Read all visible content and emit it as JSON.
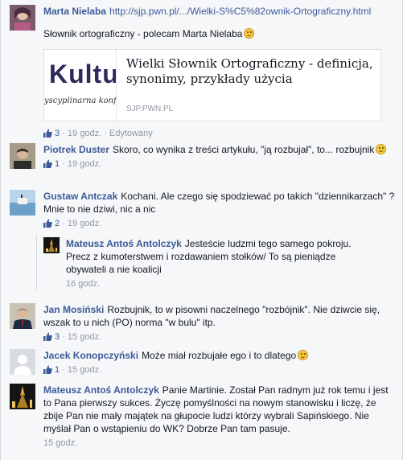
{
  "post": {
    "author": "Marta Nielaba",
    "url": "http://sjp.pwn.pl/.../Wielki-S%C5%82ownik-Ortograficzny.html",
    "text": "Słownik ortograficzny - polecam Marta Nielaba",
    "preview": {
      "logo_text": "Kultu",
      "logo_subtext": "yscyplinarna konf",
      "title": "Wielki Słownik Ortograficzny - definicja, synonimy, przykłady użycia",
      "source": "SJP.PWN.PL"
    },
    "likes": "3",
    "time": "19 godz.",
    "edited": "Edytowany"
  },
  "comments": [
    {
      "author": "Piotrek Duster",
      "text": "Skoro, co wynika z treści artykułu, \"ją rozbujał\", to... rozbujnik",
      "likes": "1",
      "time": "19 godz."
    },
    {
      "author": "Gustaw Antczak",
      "text": "Kochani. Ale czego się spodziewać po takich \"dziennikarzach\" ? Mnie to nie dziwi, nic a nic",
      "likes": "2",
      "time": "19 godz."
    },
    {
      "author": "Mateusz Antoś Antolczyk",
      "text": "Jesteście ludzmi tego samego pokroju. Precz z kumoterstwem i rozdawaniem stołków/ To są pieniądze obywateli a nie koalicji",
      "time": "16 godz."
    },
    {
      "author": "Jan Mosiński",
      "text": "Rozbujnik, to w pisowni naczelnego \"rozbójnik\". Nie dziwcie się, wszak to u nich (PO) norma \"w bulu\" itp.",
      "likes": "3",
      "time": "15 godz."
    },
    {
      "author": "Jacek Konopczyński",
      "text": "Może miał rozbujałe ego i to dlatego",
      "likes": "1",
      "time": "15 godz."
    },
    {
      "author": "Mateusz Antoś Antolczyk",
      "text": "Panie Martinie. Został Pan radnym już rok temu i jest to Pana pierwszy sukces. Życzę pomyślności na nowym stanowisku i liczę, że zbije Pan nie mały majątek na głupocie ludzi którzy wybrali Sapińskiego. Nie myślał Pan o wstąpieniu do WK? Dobrze Pan tam pasuje.",
      "time": "15 godz."
    }
  ],
  "sep": "·",
  "colors": {
    "link": "#3b5998",
    "meta": "#9197a3",
    "background": "#f6f7f9"
  }
}
